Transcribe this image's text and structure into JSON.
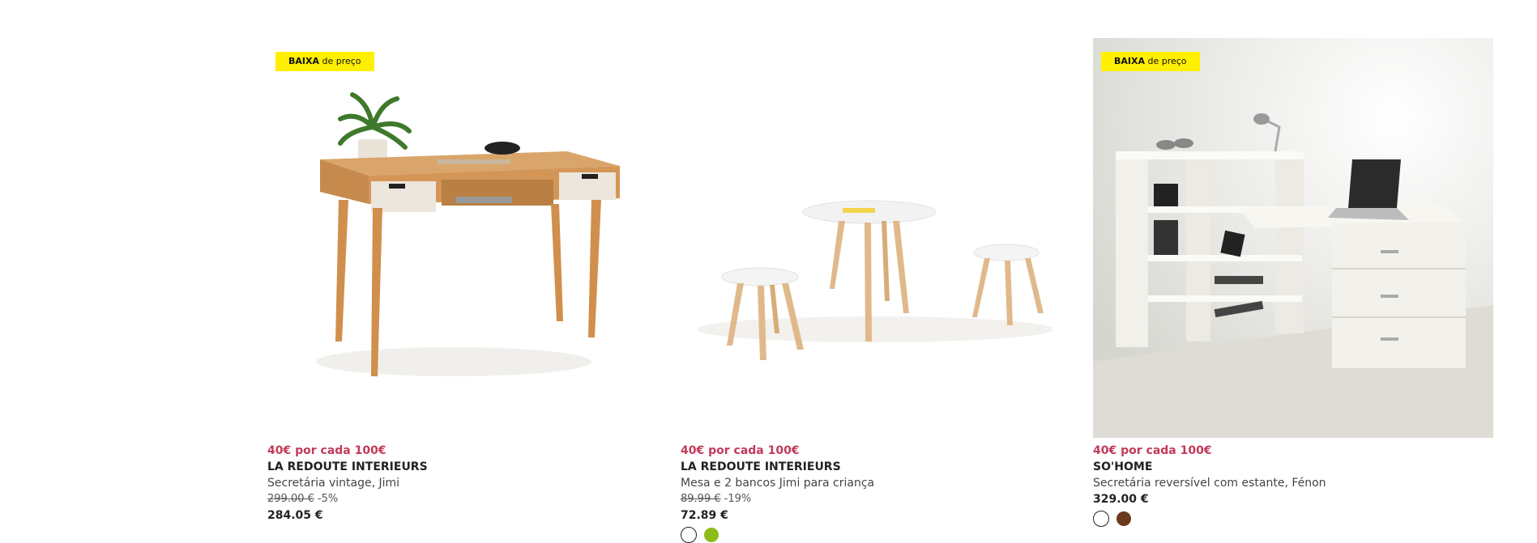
{
  "products": [
    {
      "badge": {
        "bold": "BAIXA",
        "rest": "de preço"
      },
      "image_icon": "vintage-desk-image",
      "promo": "40€ por cada 100€",
      "brand": "LA REDOUTE INTERIEURS",
      "title": "Secretária vintage, Jimi",
      "old_price": "299.00 €",
      "discount": "-5%",
      "price": "284.05 €",
      "swatches": []
    },
    {
      "badge": null,
      "image_icon": "kids-table-stools-image",
      "promo": "40€ por cada 100€",
      "brand": "LA REDOUTE INTERIEURS",
      "title": "Mesa e 2 bancos Jimi para criança",
      "old_price": "89.99 €",
      "discount": "-19%",
      "price": "72.89 €",
      "swatches": [
        "#ffffff",
        "#8cbb1a"
      ]
    },
    {
      "badge": {
        "bold": "BAIXA",
        "rest": "de preço"
      },
      "image_icon": "reversible-desk-shelf-image",
      "promo": "40€ por cada 100€",
      "brand": "SO'HOME",
      "title": "Secretária reversível com estante, Fénon",
      "old_price": null,
      "discount": null,
      "price": "329.00 €",
      "swatches": [
        "#ffffff",
        "#6b3a1f"
      ]
    }
  ],
  "colors": {
    "badge_bg": "#ffef00",
    "promo": "#c23a5a"
  }
}
